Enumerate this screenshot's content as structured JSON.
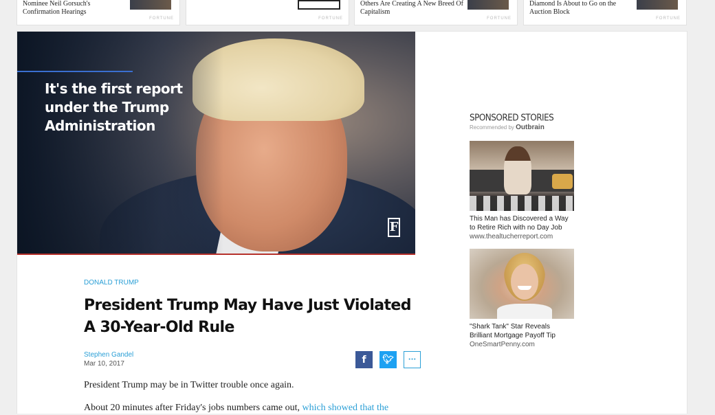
{
  "top_cards": [
    {
      "title": "Nominee Neil Gorsuch's Confirmation Hearings",
      "source": "FORTUNE"
    },
    {
      "title": "",
      "source": "FORTUNE"
    },
    {
      "title": "Others Are Creating A New Breed Of Capitalism",
      "source": "FORTUNE"
    },
    {
      "title": "Diamond Is About to Go on the Auction Block",
      "source": "FORTUNE"
    }
  ],
  "hero": {
    "quote": "It's the first report under the Trump Administration",
    "logo": "F"
  },
  "article": {
    "kicker": "DONALD TRUMP",
    "headline": "President Trump May Have Just Violated A 30-Year-Old Rule",
    "author": "Stephen Gandel",
    "date": "Mar 10, 2017",
    "share": {
      "facebook": "f",
      "twitter": "t",
      "more": "···"
    },
    "paragraph1": "President Trump may be in Twitter trouble once again.",
    "paragraph2_prefix": "About 20 minutes after Friday's jobs numbers came out, ",
    "paragraph2_link": "which showed that the"
  },
  "sponsored": {
    "title": "SPONSORED STORIES",
    "recommended_prefix": "Recommended by ",
    "recommended_brand": "Outbrain",
    "stories": [
      {
        "title": "This Man has Discovered a Way to Retire Rich with no Day Job",
        "source": "www.thealtucherreport.com"
      },
      {
        "title": "\"Shark Tank\" Star Reveals Brilliant Mortgage Payoff Tip",
        "source": "OneSmartPenny.com"
      }
    ]
  },
  "colors": {
    "accent": "#2a9fd6",
    "facebook": "#3b5998",
    "twitter": "#1da1f2",
    "hero_redline": "#b6302a"
  }
}
